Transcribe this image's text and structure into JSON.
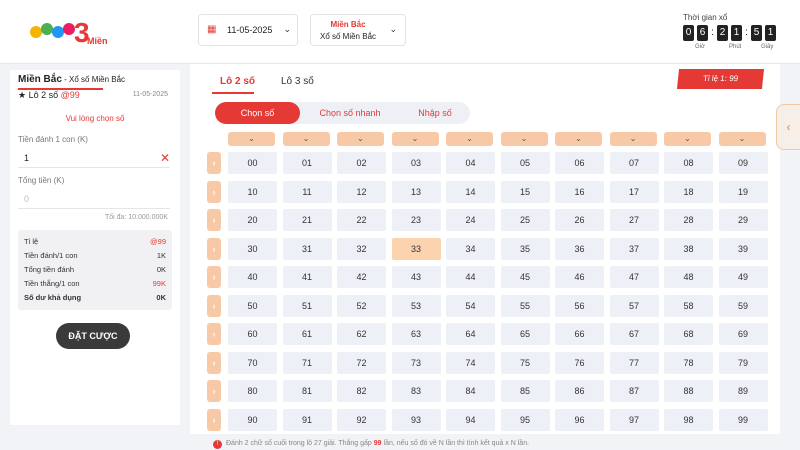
{
  "header": {
    "logo": {
      "digit": "3",
      "word": "Miền"
    },
    "date": "11-05-2025",
    "region": {
      "name": "Miền Bắc",
      "lottery": "Xổ số Miền Bắc"
    },
    "timer": {
      "label": "Thời gian xổ",
      "digits": [
        "0",
        "6",
        "2",
        "1",
        "5",
        "1"
      ],
      "units": [
        "Giờ",
        "Phút",
        "Giây"
      ]
    }
  },
  "left_panel": {
    "region": "Miền Bắc",
    "lottery": " - Xổ số Miền Bắc",
    "bet_type": "Lô 2 số",
    "bet_ratio": "@99",
    "date": "11-05-2025",
    "select_prompt": "Vui lòng chọn số",
    "stake_label": "Tiền đánh 1 con (K)",
    "stake_value": "1",
    "total_label": "Tổng tiền (K)",
    "total_value": "0",
    "max_label": "Tối đa: 10.000.000K",
    "summary": [
      {
        "label": "Tỉ lệ",
        "value": "@99",
        "red": true,
        "bold": false
      },
      {
        "label": "Tiền đánh/1 con",
        "value": "1K",
        "red": false,
        "bold": false
      },
      {
        "label": "Tổng tiền đánh",
        "value": "0K",
        "red": false,
        "bold": false
      },
      {
        "label": "Tiền thắng/1 con",
        "value": "99K",
        "red": true,
        "bold": false
      },
      {
        "label": "Số dư khả dụng",
        "value": "0K",
        "red": false,
        "bold": true
      }
    ],
    "submit_label": "ĐẶT CƯỢC"
  },
  "main": {
    "tabs": [
      "Lô 2 số",
      "Lô 3 số"
    ],
    "ratio_label": "Tỉ lệ 1: 99",
    "modes": [
      "Chọn số",
      "Chọn số nhanh",
      "Nhập số"
    ],
    "active_mode": 0,
    "numbers": [
      [
        "00",
        "01",
        "02",
        "03",
        "04",
        "05",
        "06",
        "07",
        "08",
        "09"
      ],
      [
        "10",
        "11",
        "12",
        "13",
        "14",
        "15",
        "16",
        "17",
        "18",
        "19"
      ],
      [
        "20",
        "21",
        "22",
        "23",
        "24",
        "25",
        "26",
        "27",
        "28",
        "29"
      ],
      [
        "30",
        "31",
        "32",
        "33",
        "34",
        "35",
        "36",
        "37",
        "38",
        "39"
      ],
      [
        "40",
        "41",
        "42",
        "43",
        "44",
        "45",
        "46",
        "47",
        "48",
        "49"
      ],
      [
        "50",
        "51",
        "52",
        "53",
        "54",
        "55",
        "56",
        "57",
        "58",
        "59"
      ],
      [
        "60",
        "61",
        "62",
        "63",
        "64",
        "65",
        "66",
        "67",
        "68",
        "69"
      ],
      [
        "70",
        "71",
        "72",
        "73",
        "74",
        "75",
        "76",
        "77",
        "78",
        "79"
      ],
      [
        "80",
        "81",
        "82",
        "83",
        "84",
        "85",
        "86",
        "87",
        "88",
        "89"
      ],
      [
        "90",
        "91",
        "92",
        "93",
        "94",
        "95",
        "96",
        "97",
        "98",
        "99"
      ]
    ],
    "selected": [
      "33"
    ]
  },
  "note": {
    "before": "Đánh 2 chữ số cuối trong lô 27 giải. Thắng gấp ",
    "highlight": "99",
    "after": " lần, nếu số đó về N lần thì tính kết quả x N lần."
  },
  "colors": {
    "accent": "#e53935",
    "peach": "#f7c9a6",
    "selected": "#fbd3ae"
  }
}
